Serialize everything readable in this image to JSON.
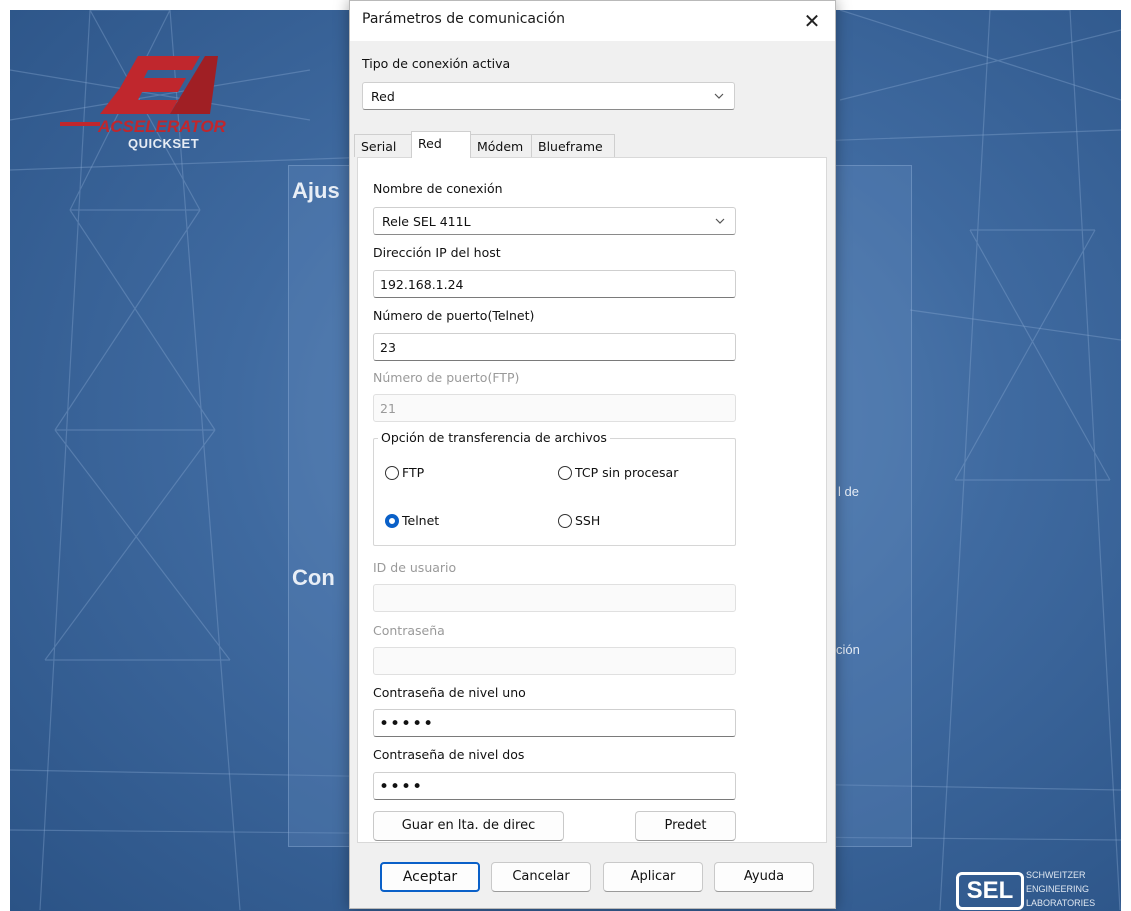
{
  "background": {
    "logo_word": "ACSELERATOR",
    "logo_sub": "QUICKSET",
    "heading1": "Ajus",
    "heading2": "Con",
    "fragment1": "l de",
    "fragment2": "ción",
    "sel_badge": "SEL",
    "sel_line1": "SCHWEITZER",
    "sel_line2": "ENGINEERING",
    "sel_line3": "LABORATORIES"
  },
  "dialog": {
    "title": "Parámetros de comunicación",
    "close_glyph": "✕",
    "connection_type_label": "Tipo de conexión activa",
    "connection_type_value": "Red",
    "tabs": [
      "Serial",
      "Red",
      "Módem",
      "Blueframe"
    ],
    "active_tab": "Red",
    "fields": {
      "connection_name_label": "Nombre de conexión",
      "connection_name_value": "Rele SEL 411L",
      "host_ip_label": "Dirección IP del host",
      "host_ip_value": "192.168.1.24",
      "telnet_port_label": "Número de puerto(Telnet)",
      "telnet_port_value": "23",
      "ftp_port_label": "Número de puerto(FTP)",
      "ftp_port_value": "21",
      "user_id_label": "ID de usuario",
      "user_id_value": "",
      "password_label": "Contraseña",
      "password_value": "",
      "level1_label": "Contraseña de nivel uno",
      "level1_value": "•••••",
      "level2_label": "Contraseña de nivel dos",
      "level2_value": "••••"
    },
    "transfer": {
      "legend": "Opción de transferencia de archivos",
      "options": {
        "ftp": "FTP",
        "tcp": "TCP sin procesar",
        "telnet": "Telnet",
        "ssh": "SSH"
      },
      "selected": "Telnet"
    },
    "buttons": {
      "save_directory": "Guar en lta. de direc",
      "default": "Predet",
      "ok": "Aceptar",
      "cancel": "Cancelar",
      "apply": "Aplicar",
      "help": "Ayuda"
    }
  },
  "colors": {
    "accent": "#0a60c8",
    "background_blue": "#3f6aa0",
    "logo_red": "#c0272d"
  }
}
